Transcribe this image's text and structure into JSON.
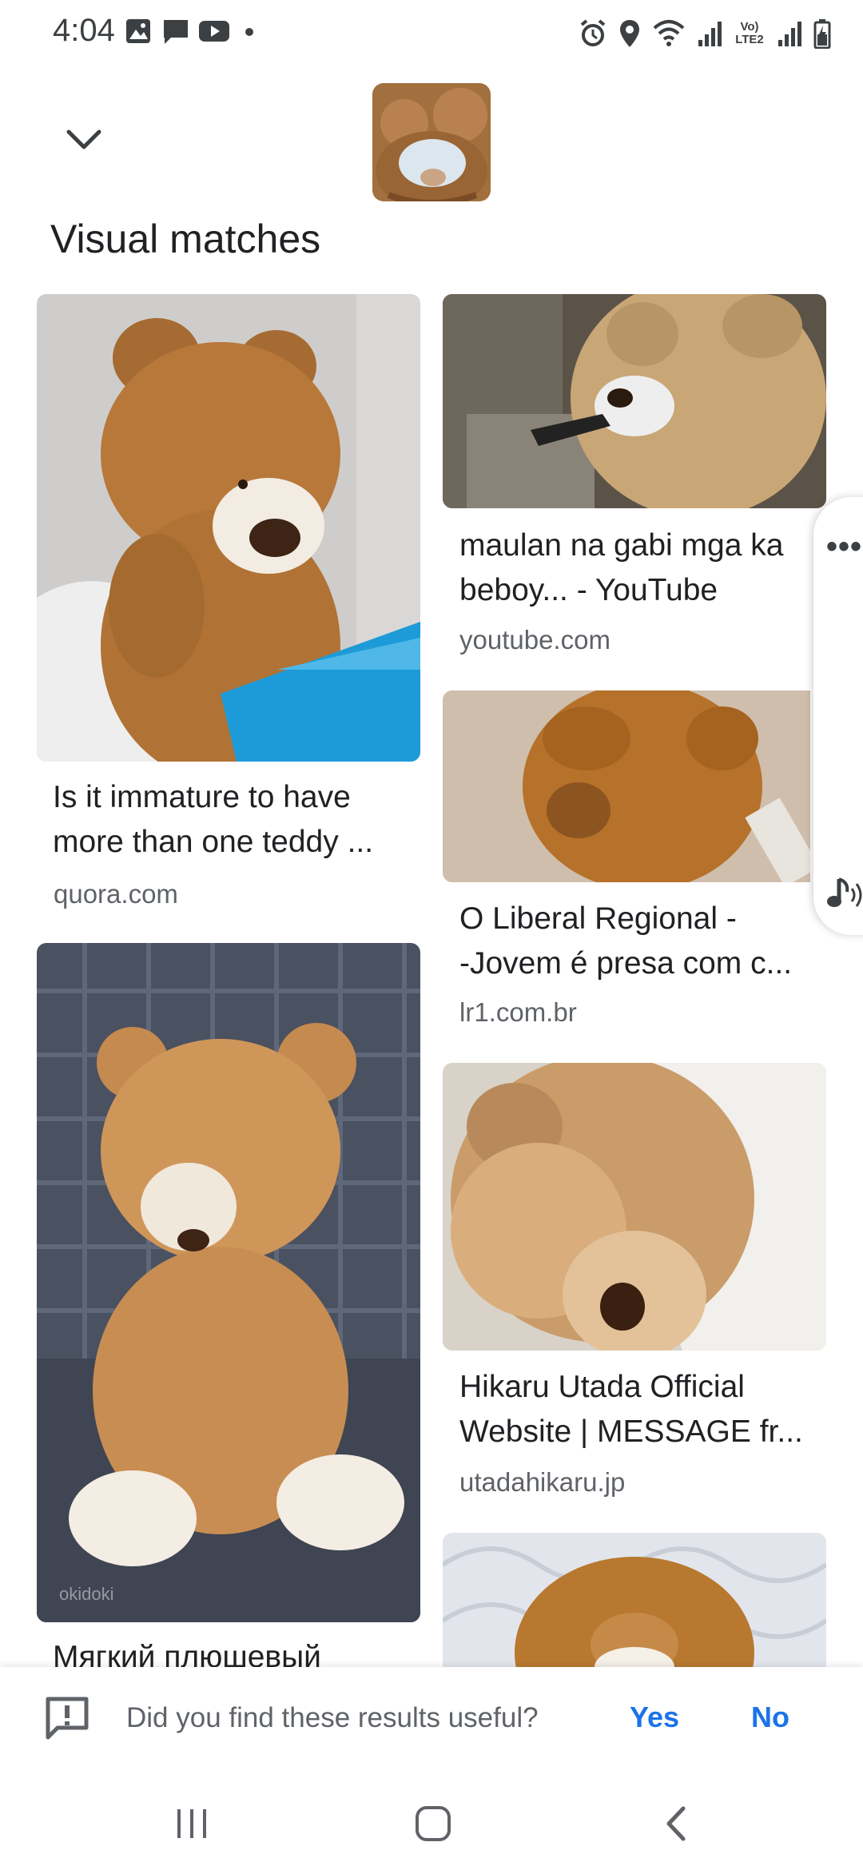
{
  "status_bar": {
    "time": "4:04",
    "left_icons": [
      "image-icon",
      "message-icon",
      "youtube-icon",
      "dot-icon"
    ],
    "right_icons": [
      "alarm-icon",
      "location-icon",
      "wifi-icon",
      "signal-icon",
      "volte-icon",
      "signal-icon",
      "battery-icon"
    ],
    "volte_label": "Vo) LTE2"
  },
  "header": {
    "collapse_icon": "chevron-down-icon",
    "query_image": "teddy-bear-query-thumbnail"
  },
  "section_title": "Visual matches",
  "results": [
    {
      "title_line1": "Is it immature to have",
      "title_line2": "more than one teddy ...",
      "source": "quora.com"
    },
    {
      "title_line1": "maulan na gabi mga ka",
      "title_line2": "beboy... - YouTube",
      "source": "youtube.com"
    },
    {
      "title_line1": "O Liberal Regional -",
      "title_line2": "-Jovem é presa com c...",
      "source": "lr1.com.br"
    },
    {
      "title_line1": "Мягкий плюшевый",
      "title_line2": "",
      "source": "",
      "watermark": "okidoki"
    },
    {
      "title_line1": "Hikaru Utada Official",
      "title_line2": "Website | MESSAGE fr...",
      "source": "utadahikaru.jp"
    },
    {
      "title_line1": "",
      "title_line2": "",
      "source": ""
    }
  ],
  "side_panel": {
    "more_label": "•••",
    "sound_icon": "music-note-icon"
  },
  "feedback": {
    "icon": "feedback-icon",
    "question": "Did you find these results useful?",
    "yes_label": "Yes",
    "no_label": "No"
  },
  "nav_bar": {
    "icons": [
      "recent-apps-icon",
      "home-icon",
      "back-icon"
    ]
  },
  "colors": {
    "accent": "#1a73e8",
    "text_primary": "#202124",
    "text_secondary": "#5f6368"
  }
}
